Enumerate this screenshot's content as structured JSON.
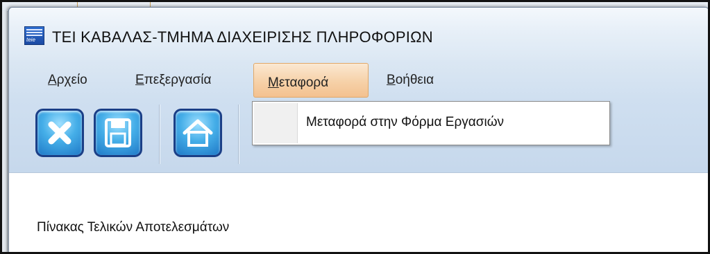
{
  "window": {
    "title": "ΤΕΙ ΚΑΒΑΛΑΣ-ΤΜΗΜΑ ΔΙΑΧΕΙΡΙΣΗΣ ΠΛΗΡΟΦΟΡΙΩΝ",
    "icon": "app-logo-icon"
  },
  "menu": {
    "items": [
      {
        "first": "Α",
        "rest": "ρχείο",
        "active": false
      },
      {
        "first": "Ε",
        "rest": "πεξεργασία",
        "active": false
      },
      {
        "first": "Μ",
        "rest": "εταφορά",
        "active": true
      },
      {
        "first": "Β",
        "rest": "οήθεια",
        "active": false
      }
    ]
  },
  "toolbar": {
    "buttons": [
      {
        "icon": "close-icon"
      },
      {
        "icon": "save-icon"
      },
      {
        "icon": "home-icon"
      }
    ]
  },
  "dropdown": {
    "items": [
      {
        "label": "Μεταφορά στην Φόρμα Εργασιών"
      }
    ]
  },
  "content": {
    "section_label": "Πίνακας Τελικών Αποτελεσμάτων"
  },
  "colors": {
    "menu_highlight": "#f6d1a8",
    "toolbar_button": "#45aee8"
  }
}
